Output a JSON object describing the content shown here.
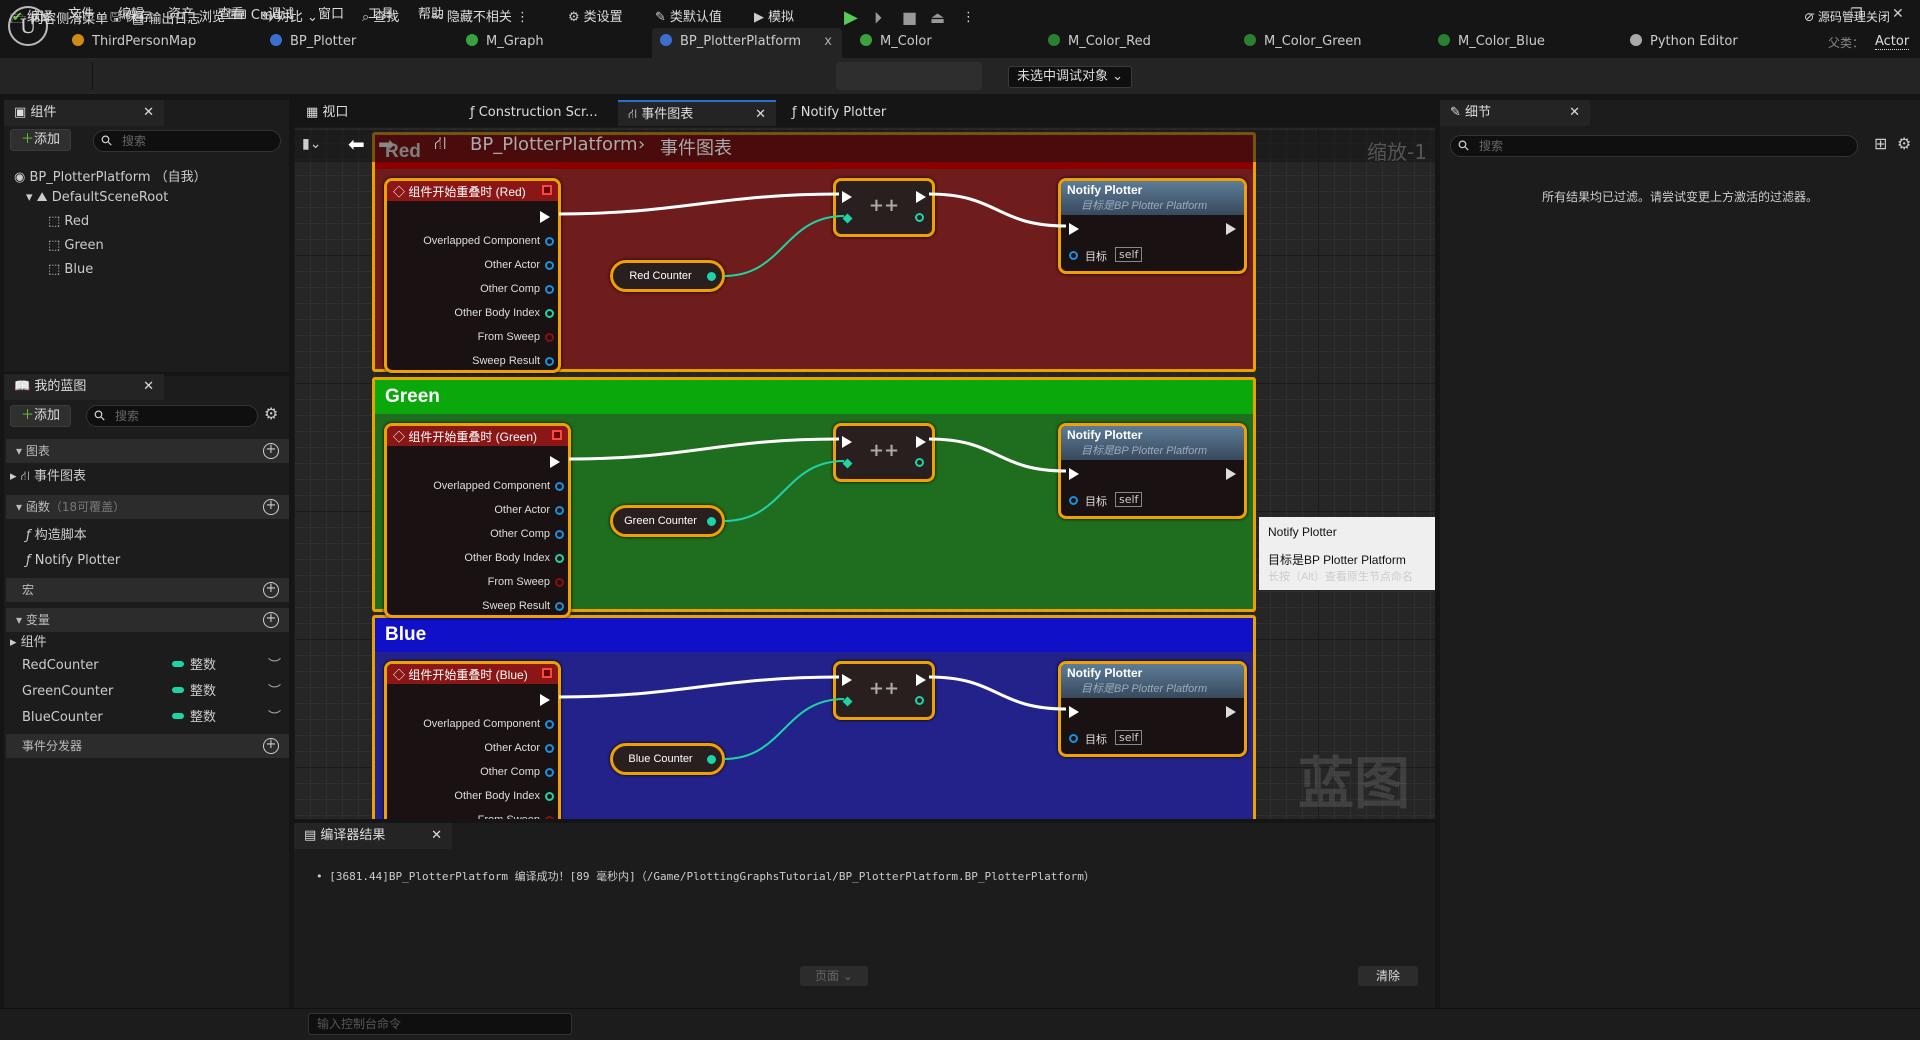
{
  "menu": [
    "文件",
    "编辑",
    "资产",
    "查看",
    "调试",
    "窗口",
    "工具",
    "帮助"
  ],
  "doc_tabs": [
    {
      "label": "ThirdPersonMap",
      "icon": "level-icon",
      "color": "#d08a1c"
    },
    {
      "label": "BP_Plotter",
      "icon": "blueprint-icon",
      "color": "#3a6fd0"
    },
    {
      "label": "M_Graph",
      "icon": "material-icon",
      "color": "#3aa040"
    },
    {
      "label": "BP_PlotterPlatform",
      "icon": "blueprint-icon",
      "color": "#3a6fd0",
      "active": true,
      "close": "x"
    },
    {
      "label": "M_Color",
      "icon": "material-icon",
      "color": "#3aa040"
    },
    {
      "label": "M_Color_Red",
      "icon": "material-instance-icon",
      "color": "#2a8030"
    },
    {
      "label": "M_Color_Green",
      "icon": "material-instance-icon",
      "color": "#2a8030"
    },
    {
      "label": "M_Color_Blue",
      "icon": "material-instance-icon",
      "color": "#2a8030"
    },
    {
      "label": "Python Editor",
      "icon": "python-icon",
      "color": "#aaaaaa"
    }
  ],
  "parent_class": {
    "label": "父类：",
    "value": "Actor"
  },
  "toolbar": {
    "compile": "编译",
    "save": "保存",
    "browse": "浏览",
    "diff": "对比",
    "find": "查找",
    "hide_unrelated": "隐藏不相关",
    "class_settings": "类设置",
    "class_defaults": "类默认值",
    "simulate": "模拟",
    "debug_target": "未选中调试对象"
  },
  "components_panel": {
    "title": "组件",
    "add": "添加",
    "search_placeholder": "搜索",
    "tree": [
      "BP_PlotterPlatform （自我）",
      "DefaultSceneRoot",
      "Red",
      "Green",
      "Blue"
    ]
  },
  "my_blueprint": {
    "title": "我的蓝图",
    "add": "添加",
    "search_placeholder": "搜索",
    "graphs": "图表",
    "event_graph": "事件图表",
    "functions": "函数",
    "functions_note": "（18可覆盖）",
    "function_items": [
      "构造脚本",
      "Notify Plotter"
    ],
    "macros": "宏",
    "variables": "变量",
    "components": "组件",
    "vars": [
      {
        "name": "RedCounter",
        "type": "整数"
      },
      {
        "name": "GreenCounter",
        "type": "整数"
      },
      {
        "name": "BlueCounter",
        "type": "整数"
      }
    ],
    "dispatchers": "事件分发器"
  },
  "graph_tabs": [
    "视口",
    "Construction Scr...",
    "事件图表",
    "Notify Plotter"
  ],
  "breadcrumb": {
    "root": "BP_PlotterPlatform",
    "current": "事件图表"
  },
  "zoom_label": "缩放-1",
  "watermark": "蓝图",
  "groups": [
    {
      "name": "Red",
      "header": "#8a0000",
      "body": "#6e1c1c",
      "title_bg": "#8a1616",
      "event": "组件开始重叠时 (Red)",
      "counter": "Red Counter"
    },
    {
      "name": "Green",
      "header": "#0aa80a",
      "body": "#1f6e1f",
      "title_bg": "#8a1616",
      "event": "组件开始重叠时 (Green)",
      "counter": "Green Counter"
    },
    {
      "name": "Blue",
      "header": "#1010c8",
      "body": "#22228a",
      "title_bg": "#8a1616",
      "event": "组件开始重叠时 (Blue)",
      "counter": "Blue Counter"
    }
  ],
  "event_pins": [
    "Overlapped Component",
    "Other Actor",
    "Other Comp",
    "Other Body Index",
    "From Sweep",
    "Sweep Result"
  ],
  "increment_label": "++",
  "notify": {
    "title": "Notify Plotter",
    "subtitle": "目标是BP Plotter Platform",
    "target": "目标",
    "self": "self"
  },
  "tooltip": {
    "title": "Notify Plotter",
    "line": "目标是BP Plotter Platform",
    "hint": "长按（Alt）查看原生节点命名"
  },
  "details": {
    "title": "细节",
    "search_placeholder": "搜索",
    "empty": "所有结果均已过滤。请尝试变更上方激活的过滤器。"
  },
  "compiler": {
    "title": "编译器结果",
    "message": "[3681.44]BP_PlotterPlatform 编译成功！[89 毫秒内]（/Game/PlottingGraphsTutorial/BP_PlotterPlatform.BP_PlotterPlatform）",
    "page": "页面",
    "clear": "清除"
  },
  "statusbar": {
    "content_drawer": "内容侧滑菜单",
    "output_log": "输出日志",
    "cmd": "Cmd",
    "console_placeholder": "输入控制台命令",
    "source_control": "源码管理关闭"
  }
}
